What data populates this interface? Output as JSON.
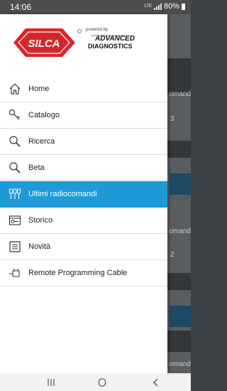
{
  "status": {
    "time": "14:06",
    "battery": "80%",
    "network": "LTE"
  },
  "logo": {
    "brand": "SILCA",
    "powered_by": "powered by",
    "partner_line1": "ADVANCED",
    "partner_line2": "DIAGNOSTICS"
  },
  "menu": [
    {
      "label": "Home",
      "icon": "home-icon"
    },
    {
      "label": "Catalogo",
      "icon": "key-icon"
    },
    {
      "label": "Ricerca",
      "icon": "search-key-icon"
    },
    {
      "label": "Beta",
      "icon": "search-key-icon"
    },
    {
      "label": "Ultimi radiocomandi",
      "icon": "keys-icon",
      "active": true
    },
    {
      "label": "Storico",
      "icon": "history-icon"
    },
    {
      "label": "Novità",
      "icon": "news-icon"
    },
    {
      "label": "Remote Programming Cable",
      "icon": "cable-icon"
    }
  ],
  "background": {
    "text1": "omand",
    "text2": "3",
    "text3": "omand",
    "text4": "2",
    "text5": "omand"
  },
  "colors": {
    "active": "#1e9bd7",
    "brand_red": "#d7262b"
  }
}
